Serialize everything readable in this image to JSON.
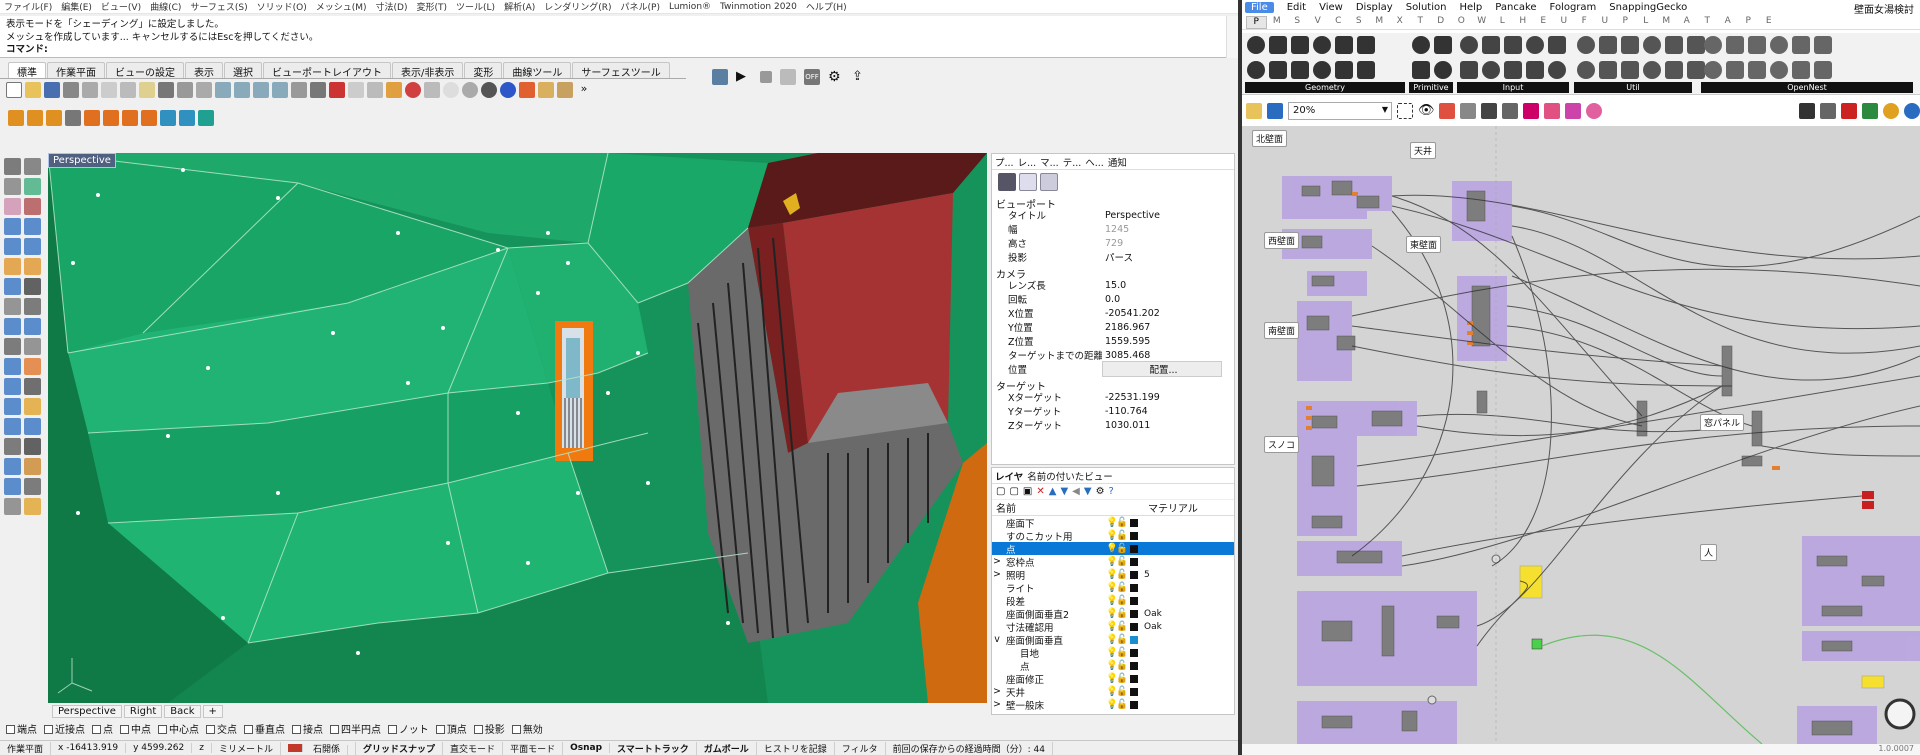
{
  "rhino": {
    "menu": [
      "ファイル(F)",
      "編集(E)",
      "ビュー(V)",
      "曲線(C)",
      "サーフェス(S)",
      "ソリッド(O)",
      "メッシュ(M)",
      "寸法(D)",
      "変形(T)",
      "ツール(L)",
      "解析(A)",
      "レンダリング(R)",
      "パネル(P)",
      "Lumion®",
      "Twinmotion 2020",
      "ヘルプ(H)"
    ],
    "command_lines": [
      "表示モードを「シェーディング」に設定しました。",
      "メッシュを作成しています... キャンセルするにはEscを押してください。"
    ],
    "command_prompt": "コマンド:",
    "tabs": [
      "標準",
      "作業平面",
      "ビューの設定",
      "表示",
      "選択",
      "ビューポートレイアウト",
      "表示/非表示",
      "変形",
      "曲線ツール",
      "サーフェスツール"
    ],
    "viewport_title": "Perspective",
    "viewport_tabs": [
      "Perspective",
      "Right",
      "Back"
    ],
    "osnaps": [
      {
        "label": "端点",
        "checked": false
      },
      {
        "label": "近接点",
        "checked": false
      },
      {
        "label": "点",
        "checked": false
      },
      {
        "label": "中点",
        "checked": false
      },
      {
        "label": "中心点",
        "checked": false
      },
      {
        "label": "交点",
        "checked": false
      },
      {
        "label": "垂直点",
        "checked": false
      },
      {
        "label": "接点",
        "checked": false
      },
      {
        "label": "四半円点",
        "checked": false
      },
      {
        "label": "ノット",
        "checked": false
      },
      {
        "label": "頂点",
        "checked": false
      },
      {
        "label": "投影",
        "checked": false
      },
      {
        "label": "無効",
        "checked": false
      }
    ],
    "status": {
      "cplane": "作業平面",
      "x": "x -16413.919",
      "y": "y 4599.262",
      "z": "z",
      "units": "ミリメートル",
      "layer": "石開係",
      "toggles": [
        "グリッドスナップ",
        "直交モード",
        "平面モード",
        "Osnap",
        "スマートトラック",
        "ガムボール",
        "ヒストリを記録",
        "フィルタ"
      ],
      "elapsed": "前回の保存からの経過時間（分）: 44"
    },
    "properties": {
      "tabs": [
        "プ...",
        "レ...",
        "マ...",
        "テ...",
        "ヘ...",
        "通知"
      ],
      "viewport_section": "ビューポート",
      "viewport_rows": [
        {
          "k": "タイトル",
          "v": "Perspective",
          "gray": false
        },
        {
          "k": "幅",
          "v": "1245",
          "gray": true
        },
        {
          "k": "高さ",
          "v": "729",
          "gray": true
        },
        {
          "k": "投影",
          "v": "パース",
          "gray": false
        }
      ],
      "camera_section": "カメラ",
      "camera_rows": [
        {
          "k": "レンズ長",
          "v": "15.0"
        },
        {
          "k": "回転",
          "v": "0.0"
        },
        {
          "k": "X位置",
          "v": "-20541.202"
        },
        {
          "k": "Y位置",
          "v": "2186.967"
        },
        {
          "k": "Z位置",
          "v": "1559.595"
        },
        {
          "k": "ターゲットまでの距離",
          "v": "3085.468"
        }
      ],
      "position_label": "位置",
      "position_button": "配置...",
      "target_section": "ターゲット",
      "target_rows": [
        {
          "k": "Xターゲット",
          "v": "-22531.199"
        },
        {
          "k": "Yターゲット",
          "v": "-110.764"
        },
        {
          "k": "Zターゲット",
          "v": "1030.011"
        }
      ]
    },
    "layers": {
      "tabs": [
        "レイヤ",
        "名前の付いたビュー"
      ],
      "col_name": "名前",
      "col_material": "マテリアル",
      "rows": [
        {
          "name": "座面下",
          "indent": 0,
          "exp": "",
          "sel": false,
          "color": "#111111",
          "mat": ""
        },
        {
          "name": "すのこカット用",
          "indent": 0,
          "exp": "",
          "sel": false,
          "color": "#111111",
          "mat": ""
        },
        {
          "name": "点",
          "indent": 0,
          "exp": "",
          "sel": true,
          "color": "#111111",
          "mat": ""
        },
        {
          "name": "窓枠点",
          "indent": 0,
          "exp": ">",
          "sel": false,
          "color": "#111111",
          "mat": ""
        },
        {
          "name": "照明",
          "indent": 0,
          "exp": ">",
          "sel": false,
          "color": "#111111",
          "mat": "5"
        },
        {
          "name": "ライト",
          "indent": 0,
          "exp": "",
          "sel": false,
          "color": "#111111",
          "mat": ""
        },
        {
          "name": "段差",
          "indent": 0,
          "exp": "",
          "sel": false,
          "color": "#111111",
          "mat": ""
        },
        {
          "name": "座面側面垂直2",
          "indent": 0,
          "exp": "",
          "sel": false,
          "color": "#111111",
          "mat": "Oak"
        },
        {
          "name": "寸法確認用",
          "indent": 0,
          "exp": "",
          "sel": false,
          "color": "#111111",
          "mat": "Oak"
        },
        {
          "name": "座面側面垂直",
          "indent": 0,
          "exp": "v",
          "sel": false,
          "color": "#1a8fd0",
          "mat": ""
        },
        {
          "name": "目地",
          "indent": 1,
          "exp": "",
          "sel": false,
          "color": "#111111",
          "mat": ""
        },
        {
          "name": "点",
          "indent": 1,
          "exp": "",
          "sel": false,
          "color": "#111111",
          "mat": ""
        },
        {
          "name": "座面修正",
          "indent": 0,
          "exp": "",
          "sel": false,
          "color": "#111111",
          "mat": ""
        },
        {
          "name": "天井",
          "indent": 0,
          "exp": ">",
          "sel": false,
          "color": "#111111",
          "mat": ""
        },
        {
          "name": "壁一般床",
          "indent": 0,
          "exp": ">",
          "sel": false,
          "color": "#111111",
          "mat": ""
        }
      ]
    }
  },
  "grasshopper": {
    "menu": [
      "File",
      "Edit",
      "View",
      "Display",
      "Solution",
      "Help",
      "Pancake",
      "Fologram",
      "SnappingGecko"
    ],
    "title_right": "壁面女湯検討",
    "tabs": [
      "P",
      "M",
      "S",
      "V",
      "C",
      "S",
      "M",
      "X",
      "T",
      "D",
      "O",
      "W",
      "L",
      "H",
      "E",
      "U",
      "F",
      "U",
      "P",
      "L",
      "M",
      "A",
      "T",
      "A",
      "P",
      "E"
    ],
    "ribbon_groups": [
      "Geometry",
      "Primitive",
      "Input",
      "Util",
      "OpenNest"
    ],
    "zoom": "20%",
    "groups": [
      {
        "label": "北壁面"
      },
      {
        "label": "天井"
      },
      {
        "label": "西壁面"
      },
      {
        "label": "東壁面"
      },
      {
        "label": "南壁面"
      },
      {
        "label": "スノコ"
      },
      {
        "label": "窓パネル"
      },
      {
        "label": "人"
      }
    ],
    "footer": "1.0.0007"
  }
}
